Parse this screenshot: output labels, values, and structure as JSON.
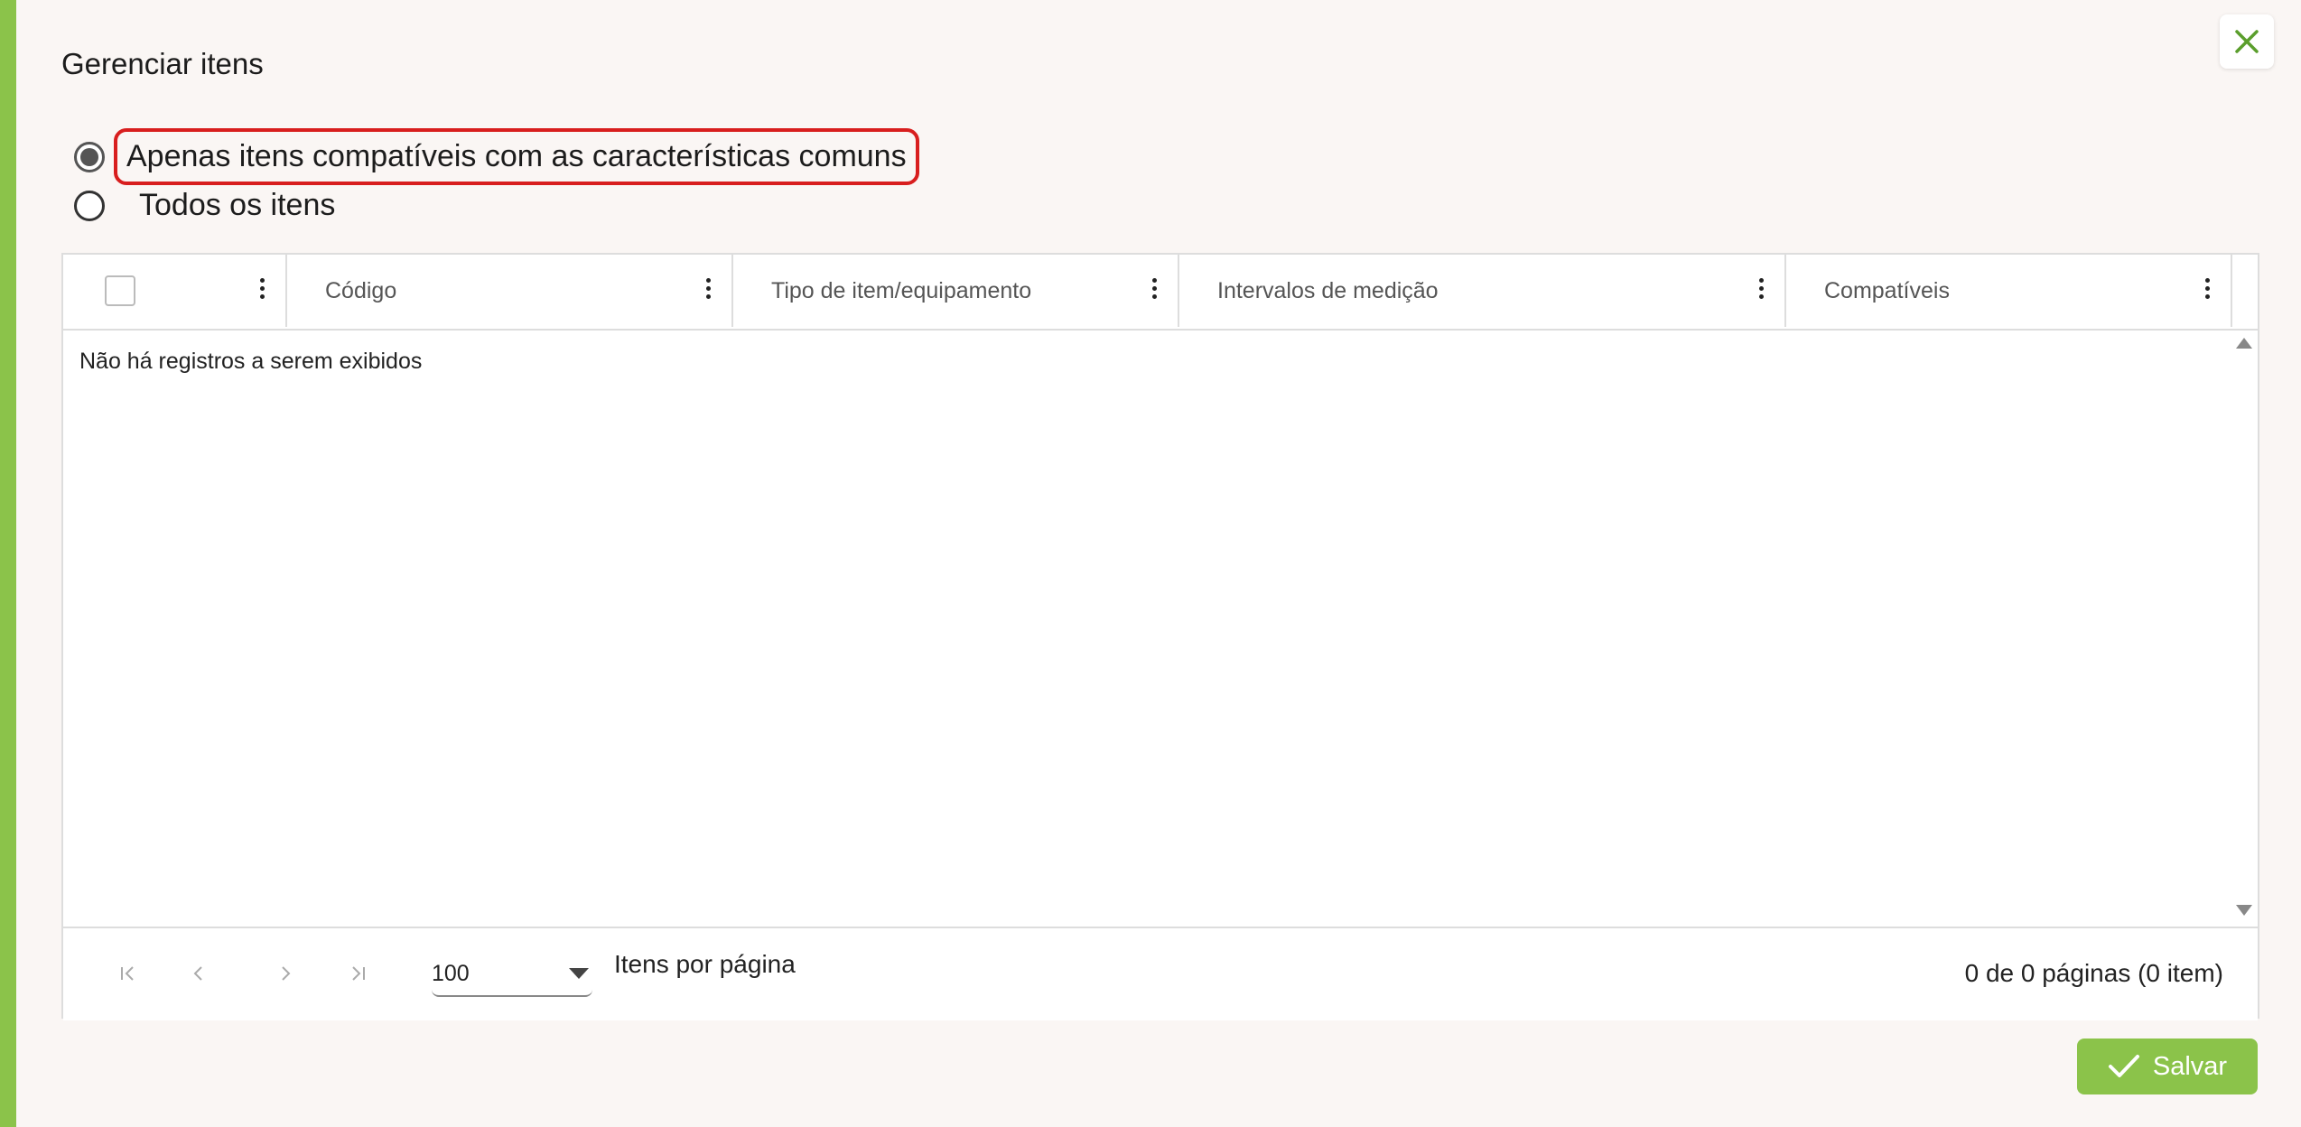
{
  "dialog": {
    "title": "Gerenciar itens"
  },
  "filter_options": [
    {
      "label": "Apenas itens compatíveis com as características comuns",
      "selected": true
    },
    {
      "label": "Todos os itens",
      "selected": false
    }
  ],
  "table": {
    "columns": [
      "Código",
      "Tipo de item/equipamento",
      "Intervalos de medição",
      "Compatíveis"
    ],
    "empty_message": "Não há registros a serem exibidos"
  },
  "pagination": {
    "page_size": "100",
    "page_size_label": "Itens por página",
    "summary": "0 de 0 páginas (0 item)"
  },
  "actions": {
    "save_label": "Salvar"
  },
  "colors": {
    "accent": "#8bc34a",
    "highlight": "#d81e1e"
  }
}
